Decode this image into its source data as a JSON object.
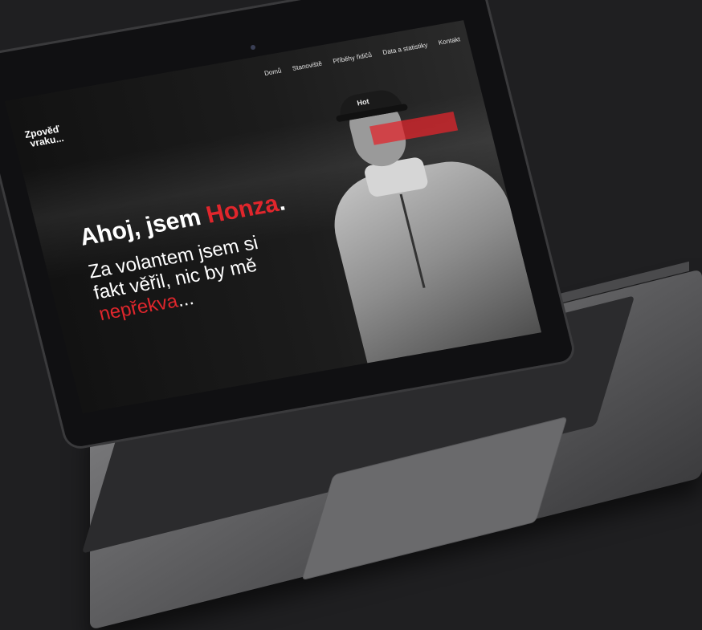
{
  "site": {
    "logo_line1": "Zpověď",
    "logo_line2": "vraku..."
  },
  "nav": {
    "items": [
      "Domů",
      "Stanoviště",
      "Příběhy řidičů",
      "Data a statistiky",
      "Kontakt"
    ]
  },
  "hero": {
    "title_prefix": "Ahoj, jsem ",
    "title_name": "Honza",
    "title_suffix": ".",
    "subtitle_line1": "Za volantem jsem si",
    "subtitle_line2": "fakt věřil, nic by mě",
    "subtitle_accent": "nepřekva",
    "subtitle_end": "..."
  },
  "portrait": {
    "cap_text": "Hot"
  },
  "colors": {
    "accent": "#e0262c",
    "background": "#1f1f21"
  }
}
